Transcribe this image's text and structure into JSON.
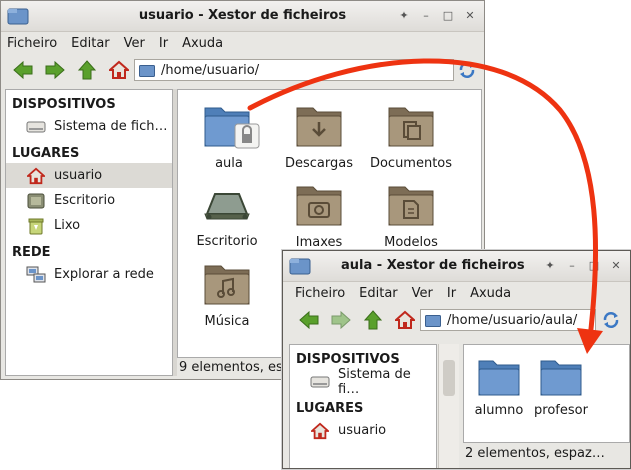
{
  "window1": {
    "title": "usuario - Xestor de ficheiros",
    "menu": [
      "Ficheiro",
      "Editar",
      "Ver",
      "Ir",
      "Axuda"
    ],
    "path": "/home/usuario/",
    "sidebar": {
      "devices_header": "DISPOSITIVOS",
      "devices": [
        {
          "label": "Sistema de fich…",
          "icon": "drive-icon"
        }
      ],
      "places_header": "LUGARES",
      "places": [
        {
          "label": "usuario",
          "icon": "home-icon",
          "selected": true
        },
        {
          "label": "Escritorio",
          "icon": "desktop-icon"
        },
        {
          "label": "Lixo",
          "icon": "trash-icon"
        }
      ],
      "network_header": "REDE",
      "network": [
        {
          "label": "Explorar a rede",
          "icon": "network-icon"
        }
      ]
    },
    "files": [
      {
        "label": "aula",
        "icon": "locked-folder-icon"
      },
      {
        "label": "Descargas",
        "icon": "downloads-folder-icon"
      },
      {
        "label": "Documentos",
        "icon": "documents-folder-icon"
      },
      {
        "label": "Escritorio",
        "icon": "desktop-folder-icon"
      },
      {
        "label": "Imaxes",
        "icon": "pictures-folder-icon"
      },
      {
        "label": "Modelos",
        "icon": "templates-folder-icon"
      },
      {
        "label": "Música",
        "icon": "music-folder-icon"
      }
    ],
    "status": "9 elementos, es"
  },
  "window2": {
    "title": "aula - Xestor de ficheiros",
    "menu": [
      "Ficheiro",
      "Editar",
      "Ver",
      "Ir",
      "Axuda"
    ],
    "path": "/home/usuario/aula/",
    "sidebar": {
      "devices_header": "DISPOSITIVOS",
      "devices": [
        {
          "label": "Sistema de fi…",
          "icon": "drive-icon"
        }
      ],
      "places_header": "LUGARES",
      "places": [
        {
          "label": "usuario",
          "icon": "home-icon"
        }
      ]
    },
    "files": [
      {
        "label": "alumno",
        "icon": "folder-icon"
      },
      {
        "label": "profesor",
        "icon": "folder-icon"
      }
    ],
    "status": "2 elementos, espaz…"
  },
  "colors": {
    "arrow": "#ee3311",
    "folder": "#5f8fc8",
    "folder_brown": "#9c8b72",
    "selection": "#dcdad5"
  }
}
